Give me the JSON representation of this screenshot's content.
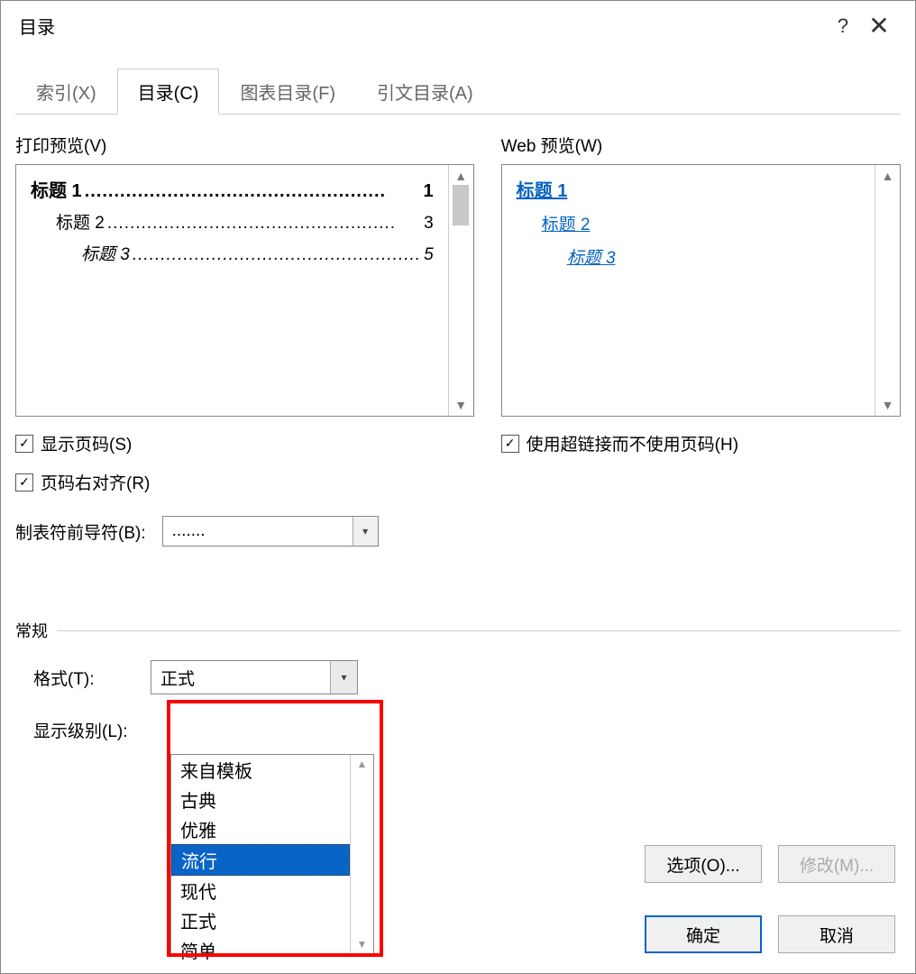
{
  "title": "目录",
  "help_icon": "?",
  "close_icon": "✕",
  "tabs": [
    {
      "label": "索引(X)"
    },
    {
      "label": "目录(C)"
    },
    {
      "label": "图表目录(F)"
    },
    {
      "label": "引文目录(A)"
    }
  ],
  "print_preview_label": "打印预览(V)",
  "web_preview_label": "Web 预览(W)",
  "toc": {
    "h1": {
      "label": "标题 1",
      "page": "1"
    },
    "h2": {
      "label": "标题 2",
      "page": "3"
    },
    "h3": {
      "label": "标题 3",
      "page": "5"
    }
  },
  "web": {
    "h1": "标题 1",
    "h2": "标题 2",
    "h3": "标题 3"
  },
  "show_page_numbers": "显示页码(S)",
  "right_align_page_numbers": "页码右对齐(R)",
  "tab_leader_label": "制表符前导符(B):",
  "tab_leader_value": ".......",
  "use_hyperlinks": "使用超链接而不使用页码(H)",
  "general_label": "常规",
  "format_label": "格式(T):",
  "format_selected": "正式",
  "show_levels_label": "显示级别(L):",
  "dropdown_options": [
    "来自模板",
    "古典",
    "优雅",
    "流行",
    "现代",
    "正式",
    "简单"
  ],
  "dropdown_highlight_index": 3,
  "options_button": "选项(O)...",
  "modify_button": "修改(M)...",
  "ok_button": "确定",
  "cancel_button": "取消",
  "leader_dots": "...................................................",
  "leader_dots2": "...................................................",
  "leader_dots3": "..................................................."
}
